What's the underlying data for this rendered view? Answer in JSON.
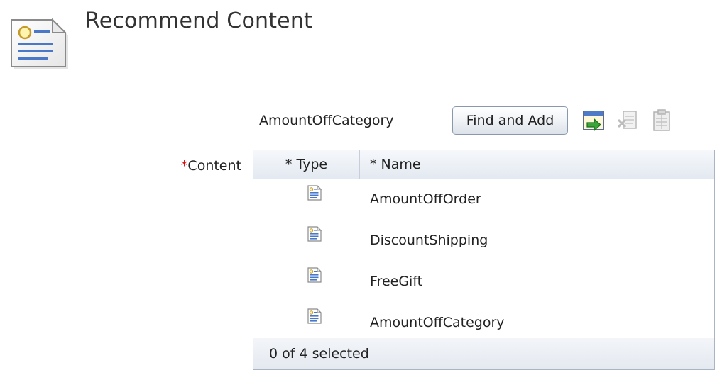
{
  "page": {
    "title": "Recommend Content",
    "icon": "content-document-icon"
  },
  "search": {
    "value": "AmountOffCategory",
    "find_add_label": "Find and Add"
  },
  "toolbar": {
    "icons": [
      "browse-icon",
      "delete-icon",
      "properties-icon"
    ]
  },
  "content_field": {
    "required_mark": "*",
    "label": "Content"
  },
  "table": {
    "columns": [
      "* Type",
      "* Name"
    ],
    "rows": [
      {
        "type_icon": "content-type-icon",
        "name": "AmountOffOrder"
      },
      {
        "type_icon": "content-type-icon",
        "name": "DiscountShipping"
      },
      {
        "type_icon": "content-type-icon",
        "name": "FreeGift"
      },
      {
        "type_icon": "content-type-icon",
        "name": "AmountOffCategory"
      }
    ],
    "status": "0 of 4 selected"
  }
}
